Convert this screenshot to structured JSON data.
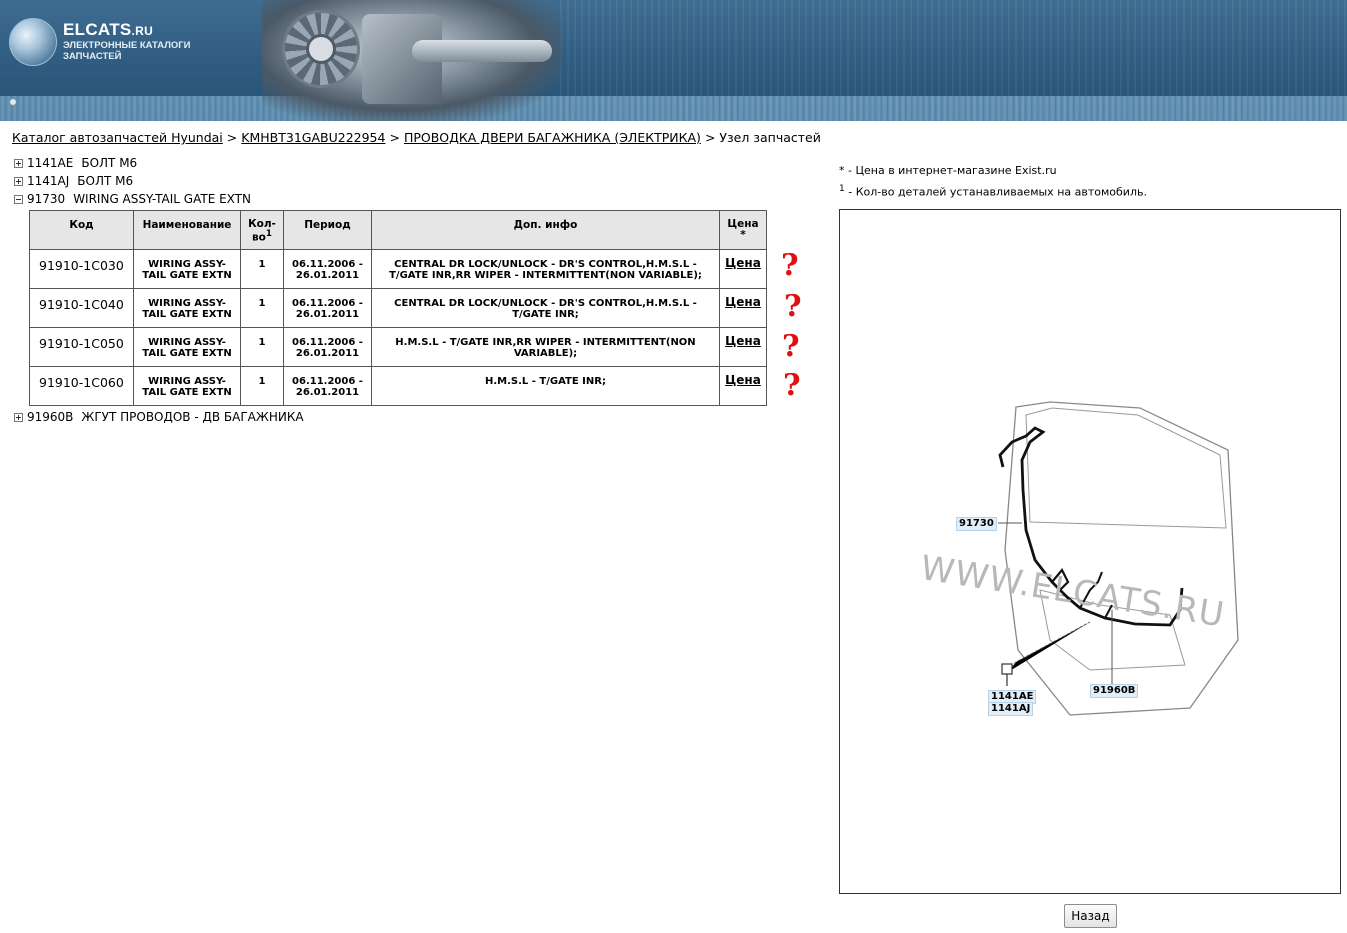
{
  "header": {
    "logo_title": "ELCATS",
    "logo_domain": ".RU",
    "logo_subtitle_line1": "ЭЛЕКТРОННЫЕ КАТАЛОГИ",
    "logo_subtitle_line2": "ЗАПЧАСТЕЙ"
  },
  "breadcrumb": {
    "items": [
      "Каталог автозапчастей Hyundai",
      "KMHBT31GABU222954",
      "ПРОВОДКА ДВЕРИ БАГАЖНИКА (ЭЛЕКТРИКА)"
    ],
    "separator": ">",
    "current": "Узел запчастей"
  },
  "tree": [
    {
      "code": "1141AE",
      "name": "БОЛТ M6",
      "expanded": false
    },
    {
      "code": "1141AJ",
      "name": "БОЛТ M6",
      "expanded": false
    },
    {
      "code": "91730",
      "name": "WIRING ASSY-TAIL GATE EXTN",
      "expanded": true
    },
    {
      "code": "91960B",
      "name": "ЖГУТ ПРОВОДОВ - ДВ БАГАЖНИКА",
      "expanded": false
    }
  ],
  "table": {
    "headers": {
      "code": "Код",
      "name": "Наименование",
      "qty_1": "Кол-",
      "qty_2": "во",
      "qty_sup": "1",
      "period": "Период",
      "info": "Доп. инфо",
      "price_1": "Цена",
      "price_2": "*"
    },
    "rows": [
      {
        "code": "91910-1C030",
        "name_1": "WIRING ASSY-",
        "name_2": "TAIL GATE EXTN",
        "qty": "1",
        "period_1": "06.11.2006 -",
        "period_2": "26.01.2011",
        "info_1": "CENTRAL DR LOCK/UNLOCK - DR'S CONTROL,H.M.S.L -",
        "info_2": "T/GATE INR,RR WIPER - INTERMITTENT(NON VARIABLE);",
        "price": "Цена"
      },
      {
        "code": "91910-1C040",
        "name_1": "WIRING ASSY-",
        "name_2": "TAIL GATE EXTN",
        "qty": "1",
        "period_1": "06.11.2006 -",
        "period_2": "26.01.2011",
        "info_1": "CENTRAL DR LOCK/UNLOCK - DR'S CONTROL,H.M.S.L -",
        "info_2": "T/GATE INR;",
        "price": "Цена"
      },
      {
        "code": "91910-1C050",
        "name_1": "WIRING ASSY-",
        "name_2": "TAIL GATE EXTN",
        "qty": "1",
        "period_1": "06.11.2006 -",
        "period_2": "26.01.2011",
        "info_1": "H.M.S.L - T/GATE INR,RR WIPER - INTERMITTENT(NON",
        "info_2": "VARIABLE);",
        "price": "Цена"
      },
      {
        "code": "91910-1C060",
        "name_1": "WIRING ASSY-",
        "name_2": "TAIL GATE EXTN",
        "qty": "1",
        "period_1": "06.11.2006 -",
        "period_2": "26.01.2011",
        "info_1": "H.M.S.L - T/GATE INR;",
        "info_2": "",
        "price": "Цена"
      }
    ]
  },
  "annotations": {
    "mark": "?",
    "count": 4,
    "color": "#e01010"
  },
  "notes": {
    "star_note": "* - Цена в интернет-магазине Exist.ru",
    "qty_note_sup": "1",
    "qty_note": " - Кол-во деталей устанавливаемых на автомобиль."
  },
  "diagram": {
    "watermark": "WWW.ELCATS.RU",
    "callouts": [
      "91730",
      "1141AE",
      "1141AJ",
      "91960B"
    ]
  },
  "back_button": "Назад"
}
